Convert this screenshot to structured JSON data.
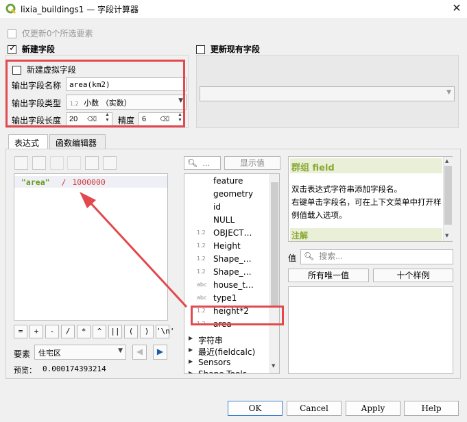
{
  "window": {
    "title": "lixia_buildings1 — 字段计算器",
    "close": "✕"
  },
  "only_update": {
    "label": "仅更新0个所选要素",
    "checked": false
  },
  "new_field": {
    "label": "新建字段",
    "checked": true
  },
  "update_existing": {
    "label": "更新现有字段",
    "checked": false
  },
  "virtual_field": {
    "label": "新建虚拟字段",
    "checked": false
  },
  "output_name": {
    "label": "输出字段名称",
    "value": "area(km2)"
  },
  "output_type": {
    "label": "输出字段类型",
    "value": "小数 （实数）",
    "type_icon": "1.2"
  },
  "output_length": {
    "label": "输出字段长度",
    "value": "20",
    "precision_label": "精度",
    "precision_value": "6"
  },
  "tabs": [
    {
      "label": "表达式",
      "active": true
    },
    {
      "label": "函数编辑器",
      "active": false
    }
  ],
  "expression": {
    "field": "\"area\"",
    "operator": "/",
    "number": "1000000"
  },
  "operators": [
    "=",
    "+",
    "-",
    "/",
    "*",
    "^",
    "||",
    "(",
    ")",
    "'\\n'"
  ],
  "feature": {
    "label": "要素",
    "value": "住宅区"
  },
  "preview": {
    "label": "预览：",
    "value": "0.000174393214"
  },
  "search": {
    "placeholder": "…",
    "show_values": "显示值"
  },
  "function_list": [
    {
      "type": "",
      "name": "feature"
    },
    {
      "type": "",
      "name": "geometry"
    },
    {
      "type": "",
      "name": "id"
    },
    {
      "type": "",
      "name": "NULL"
    },
    {
      "type": "1.2",
      "name": "OBJECT…"
    },
    {
      "type": "1.2",
      "name": "Height"
    },
    {
      "type": "1.2",
      "name": "Shape_…"
    },
    {
      "type": "1.2",
      "name": "Shape_…"
    },
    {
      "type": "abc",
      "name": "house_t…"
    },
    {
      "type": "abc",
      "name": "type1"
    },
    {
      "type": "1.2",
      "name": "height*2"
    },
    {
      "type": "1.2",
      "name": "area"
    }
  ],
  "groups": [
    "字符串",
    "最近(fieldcalc)",
    "Sensors",
    "Shape Tools"
  ],
  "help": {
    "title": "群组 field",
    "line1": "双击表达式字符串添加字段名。",
    "line2": "右键单击字段名，可在上下文菜单中打开样例值载入选项。",
    "notes": "注解"
  },
  "values": {
    "label": "值",
    "search_placeholder": "搜索...",
    "all_unique": "所有唯一值",
    "ten_samples": "十个样例"
  },
  "buttons": {
    "ok": "OK",
    "cancel": "Cancel",
    "apply": "Apply",
    "help": "Help"
  },
  "colors": {
    "annotation_red": "#e2484c",
    "qgis_green": "#6ca33a",
    "help_title": "#8aa833",
    "expr_field": "#6d9a1f",
    "expr_op": "#cc3b3b"
  }
}
